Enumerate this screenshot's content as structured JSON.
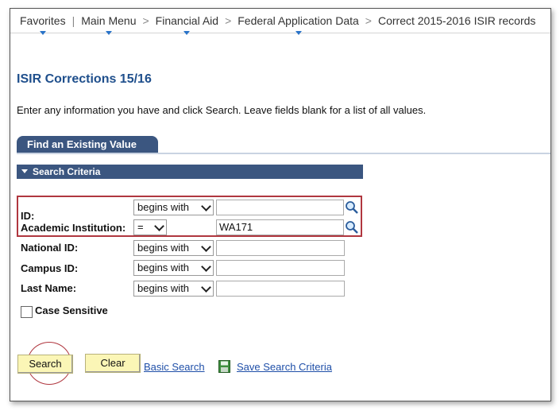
{
  "nav": {
    "items": [
      "Favorites",
      "Main Menu",
      "Financial Aid",
      "Federal Application Data",
      "Correct 2015-2016 ISIR records"
    ]
  },
  "page": {
    "title": "ISIR Corrections 15/16",
    "instructions": "Enter any information you have and click Search. Leave fields blank for a list of all values."
  },
  "tab": {
    "label": "Find an Existing Value"
  },
  "criteria": {
    "header": "Search Criteria",
    "fields": [
      {
        "label": "ID:",
        "operator": "begins with",
        "value": ""
      },
      {
        "label": "Academic Institution:",
        "operator": "=",
        "value": "WA171"
      },
      {
        "label": "National ID:",
        "operator": "begins with",
        "value": ""
      },
      {
        "label": "Campus ID:",
        "operator": "begins with",
        "value": ""
      },
      {
        "label": "Last Name:",
        "operator": "begins with",
        "value": ""
      }
    ],
    "case_sensitive_label": "Case Sensitive"
  },
  "actions": {
    "search": "Search",
    "clear": "Clear",
    "basic_search": "Basic Search",
    "save_criteria": "Save Search Criteria"
  },
  "colors": {
    "accent": "#3b5680",
    "title": "#1f4f8c",
    "highlight": "#b0373f",
    "button": "#fbf6b6"
  }
}
